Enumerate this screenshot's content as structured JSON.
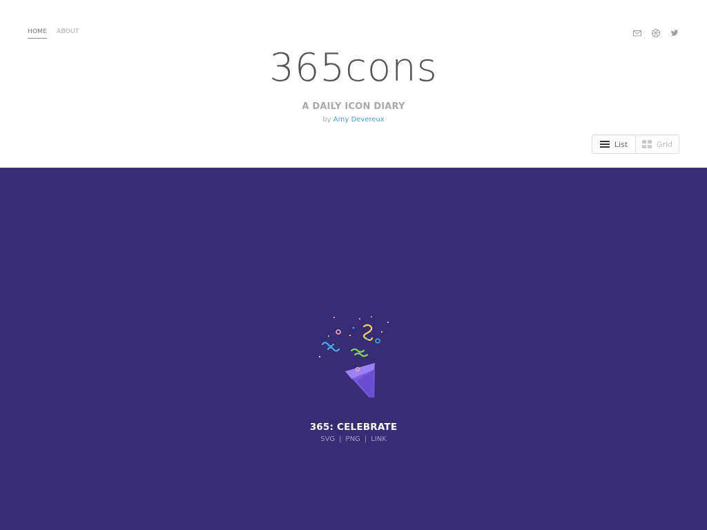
{
  "nav": {
    "home": "HOME",
    "about": "ABOUT"
  },
  "social": [
    "mail-icon",
    "dribbble-icon",
    "twitter-icon"
  ],
  "header": {
    "logo": "365cons",
    "tagline": "A DAILY ICON DIARY",
    "by_prefix": "by",
    "author": "Amy Devereux"
  },
  "view_toggle": {
    "list_label": "List",
    "grid_label": "Grid"
  },
  "featured": {
    "title": "365: CELEBRATE",
    "links": [
      "SVG",
      "PNG",
      "LINK"
    ]
  },
  "colors": {
    "stage_bg": "#382d73",
    "accent_link": "#4a9ecb",
    "cone": "#8a6cf0"
  }
}
